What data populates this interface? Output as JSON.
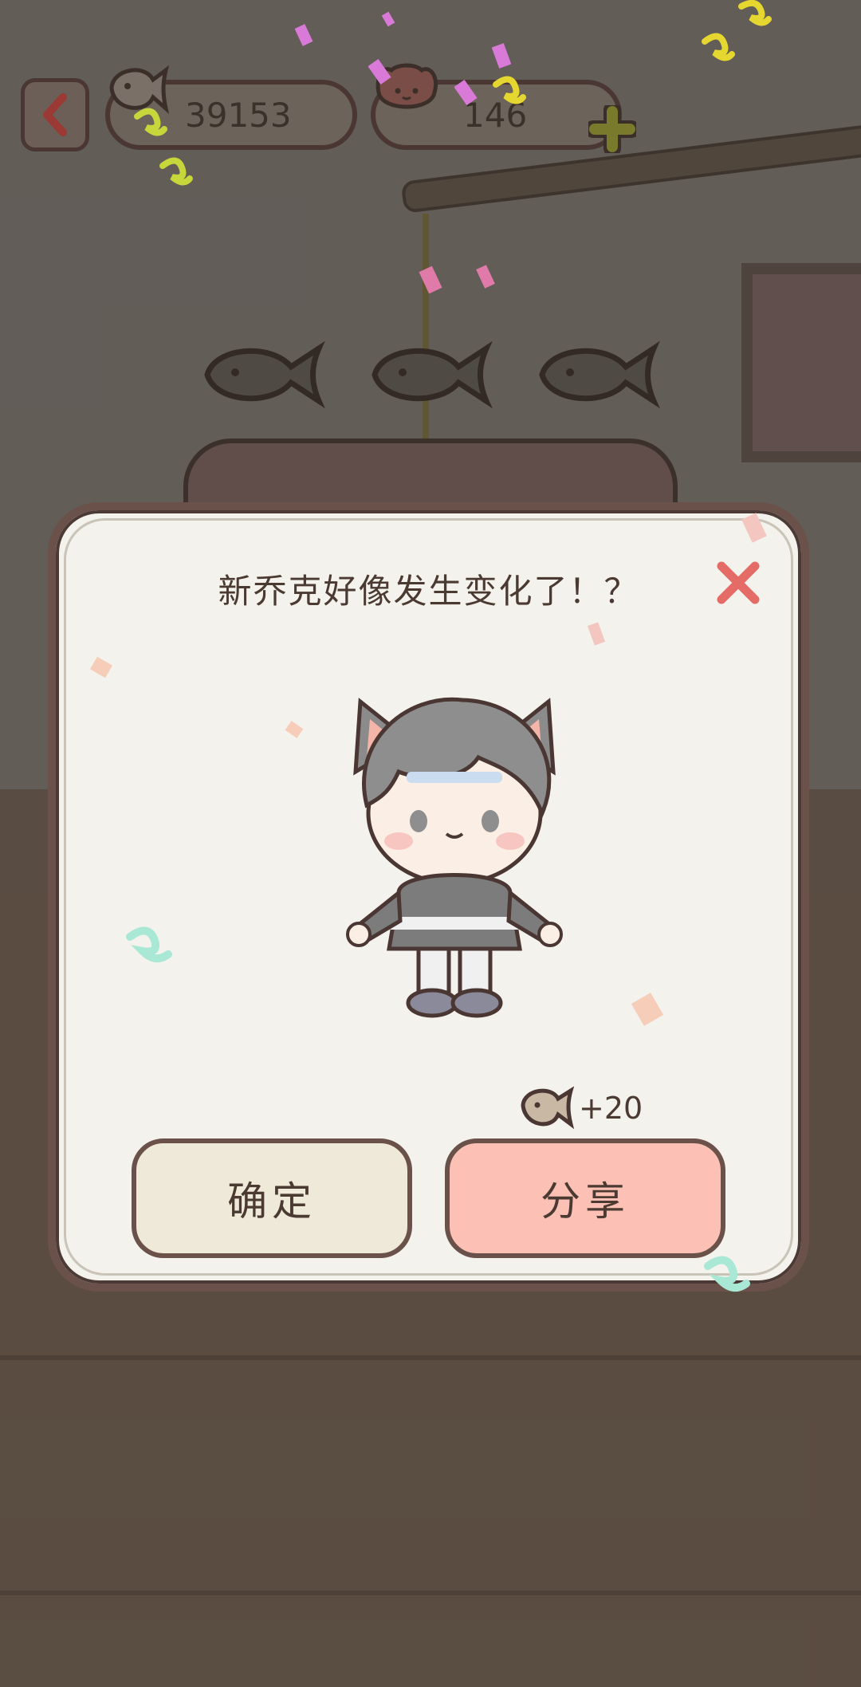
{
  "top_bar": {
    "fish_count": "39153",
    "heart_count": "146",
    "back_icon": "chevron-left-icon",
    "add_icon": "plus-icon"
  },
  "dialog": {
    "title": "新乔克好像发生变化了！？",
    "reward_text": "+20",
    "confirm_label": "确定",
    "share_label": "分享",
    "close_icon": "close-x-icon"
  },
  "colors": {
    "confirm_bg": "#efe9d9",
    "share_bg": "#fcc0b4",
    "close": "#e46b66",
    "border": "#6a514a"
  }
}
